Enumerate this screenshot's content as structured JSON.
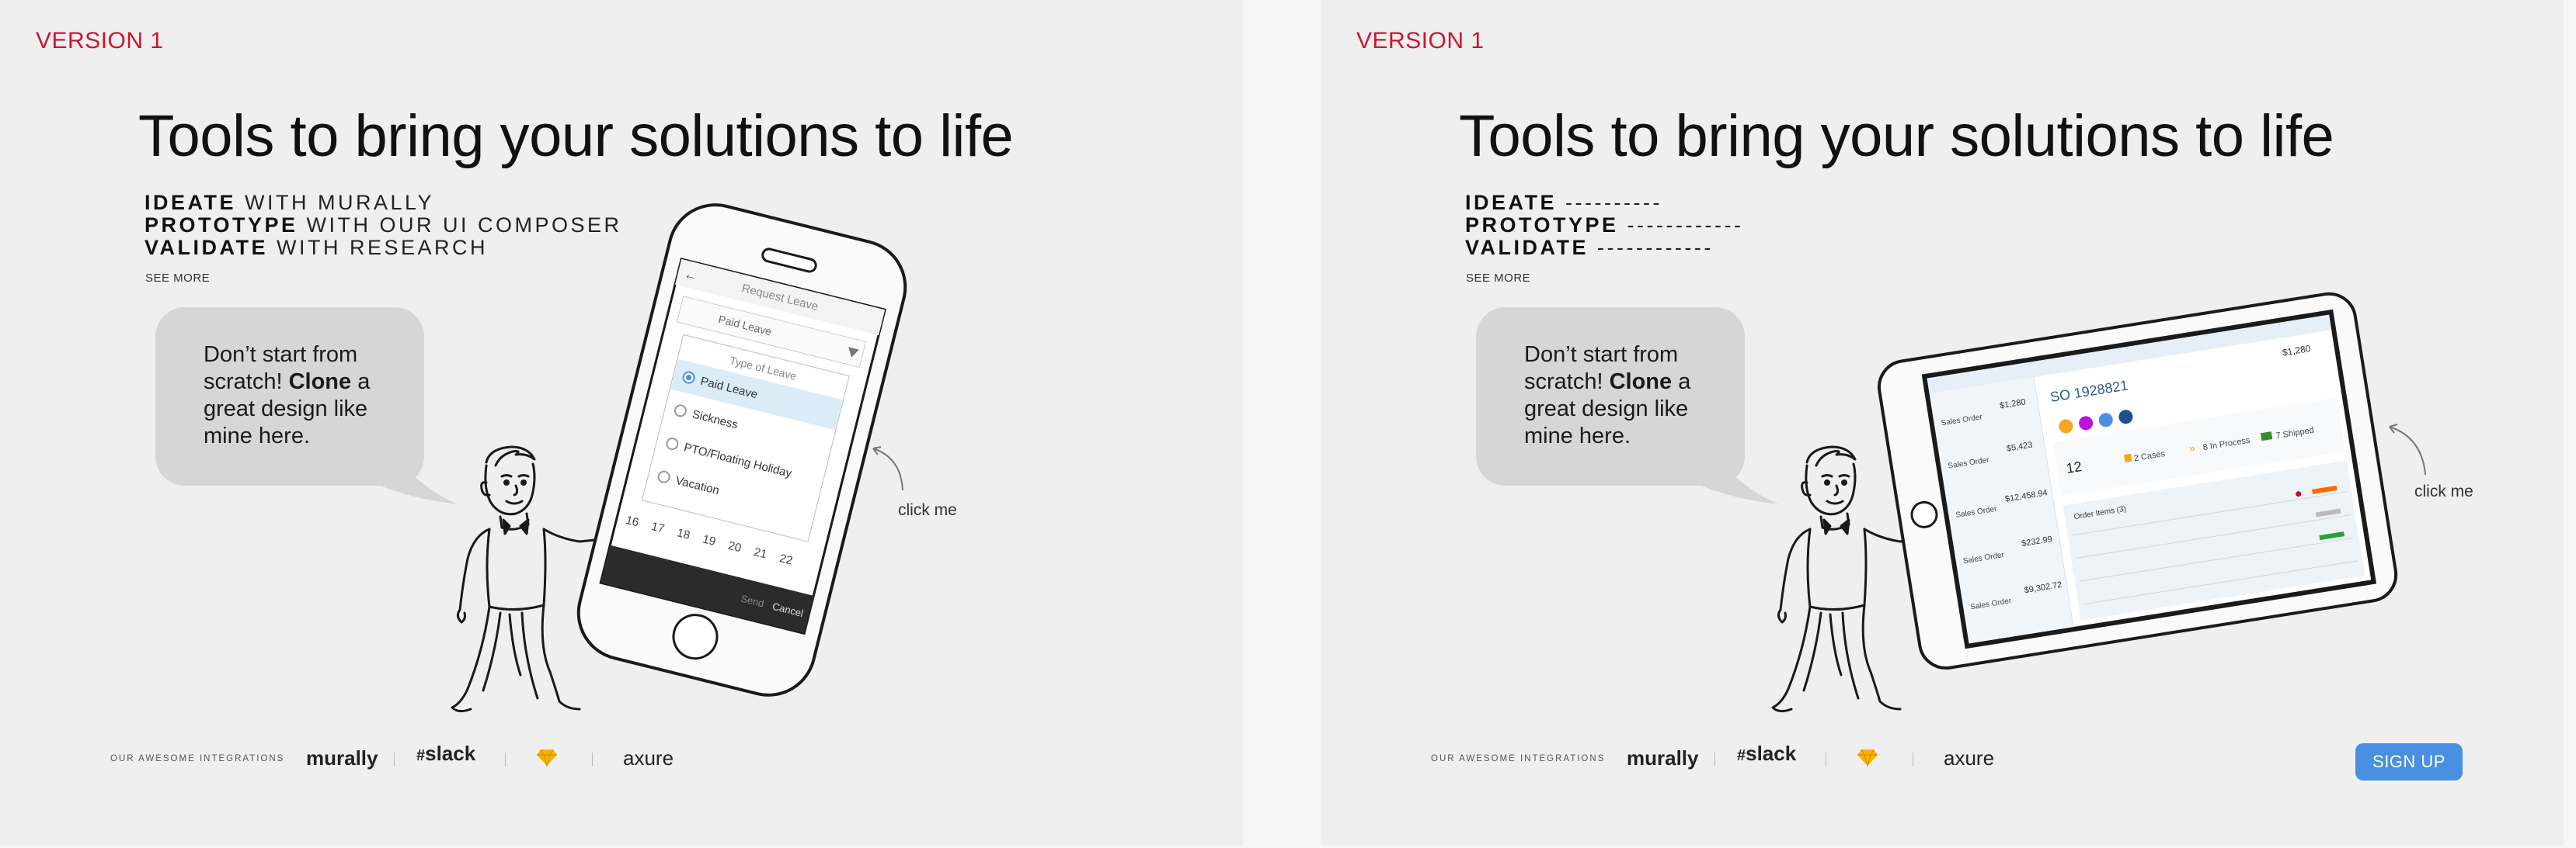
{
  "versions": [
    {
      "version_label": "VERSION 1",
      "headline": "Tools to bring your solutions to life",
      "features": [
        {
          "strong": "IDEATE",
          "rest": " WITH MURALLY"
        },
        {
          "strong": "PROTOTYPE",
          "rest": " WITH OUR UI COMPOSER"
        },
        {
          "strong": "VALIDATE",
          "rest": " WITH RESEARCH"
        }
      ],
      "see_more": "SEE MORE",
      "bubble": {
        "pre": "Don’t start from scratch! ",
        "strong": "Clone",
        "post": " a great design like mine here."
      },
      "click_me": "click me",
      "integrations": {
        "label": "OUR AWESOME INTEGRATIONS",
        "logos": [
          "murally",
          "slack",
          "axure"
        ]
      },
      "phone": {
        "title": "Request Leave",
        "select_value": "Paid Leave",
        "dropdown_title": "Type of Leave",
        "options": [
          "Paid Leave",
          "Sickness",
          "PTO/Floating Holiday",
          "Vacation"
        ],
        "calendar_days": [
          "16",
          "17",
          "18",
          "19",
          "20",
          "21",
          "22"
        ],
        "buttons": [
          "Send",
          "Cancel"
        ]
      }
    },
    {
      "version_label": "VERSION 1",
      "headline": "Tools to bring your solutions to life",
      "features": [
        {
          "strong": "IDEATE",
          "rest": " ----------"
        },
        {
          "strong": "PROTOTYPE",
          "rest": " ------------"
        },
        {
          "strong": "VALIDATE",
          "rest": " ------------"
        }
      ],
      "see_more": "SEE MORE",
      "bubble": {
        "pre": "Don’t start from scratch! ",
        "strong": "Clone",
        "post": " a great design like mine here."
      },
      "click_me": "click me",
      "integrations": {
        "label": "OUR AWESOME INTEGRATIONS",
        "logos": [
          "murally",
          "slack",
          "axure"
        ]
      },
      "signup": "SIGN UP",
      "tablet": {
        "order_number": "SO 1928821",
        "amount_top": "$1,280",
        "sidebar_orders": [
          {
            "label": "Sales Order",
            "amount": "$1,280"
          },
          {
            "label": "Sales Order",
            "amount": "$5,423"
          },
          {
            "label": "Sales Order",
            "amount": "$12,458.94"
          },
          {
            "label": "Sales Order",
            "amount": "$232.99"
          },
          {
            "label": "Sales Order",
            "amount": "$9,302.72"
          }
        ],
        "stats": [
          "12",
          "2 Cases",
          "8 In Process",
          "7 Shipped"
        ],
        "table_title": "Order Items (3)"
      }
    }
  ],
  "colors": {
    "version": "#cc1630",
    "signup": "#4a90e2",
    "bubble": "#d6d6d6",
    "radio_active": "#4a90e2"
  }
}
